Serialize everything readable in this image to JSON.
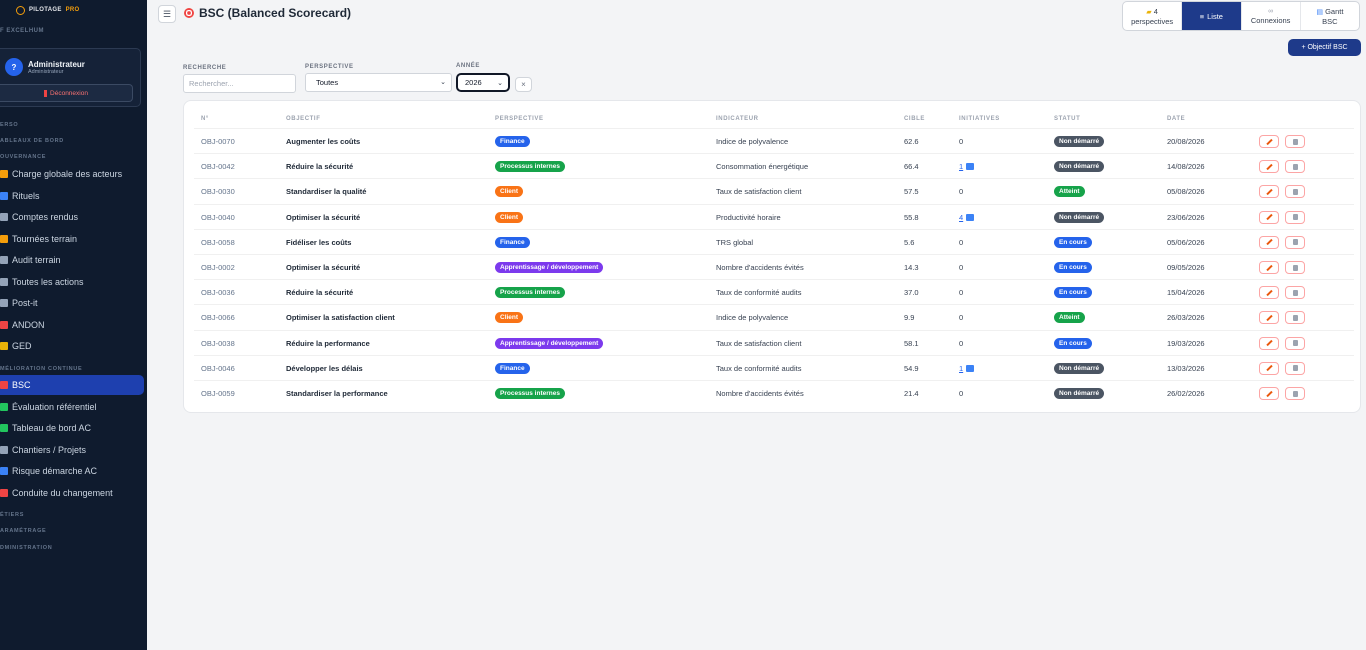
{
  "sidebar": {
    "logo_text": "PILOTAGE",
    "logo_accent": "PRO",
    "company": "F EXCELHUM",
    "user": {
      "avatar_letter": "?",
      "name": "Administrateur",
      "role": "Administrateur",
      "logout_label": "Déconnexion"
    },
    "sections": {
      "verso": "ERSO",
      "tableaux": "ABLEAUX DE BORD",
      "gouvernance": "OUVERNANCE",
      "amelioration": "MÉLIORATION CONTINUE",
      "metiers": "ÉTIERS",
      "parametrage": "ARAMÉTRAGE",
      "administration": "DMINISTRATION"
    },
    "gouvernance_items": [
      {
        "label": "Charge globale des acteurs",
        "icon": "scale-icon",
        "color": "#f59e0b"
      },
      {
        "label": "Rituels",
        "icon": "calendar-icon",
        "color": "#3b82f6"
      },
      {
        "label": "Comptes rendus",
        "icon": "document-icon",
        "color": "#94a3b8"
      },
      {
        "label": "Tournées terrain",
        "icon": "walker-icon",
        "color": "#f59e0b"
      },
      {
        "label": "Audit terrain",
        "icon": "clipboard-icon",
        "color": "#94a3b8"
      },
      {
        "label": "Toutes les actions",
        "icon": "list-icon",
        "color": "#94a3b8"
      },
      {
        "label": "Post-it",
        "icon": "note-icon",
        "color": "#94a3b8"
      },
      {
        "label": "ANDON",
        "icon": "alert-light-icon",
        "color": "#ef4444"
      },
      {
        "label": "GED",
        "icon": "folder-icon",
        "color": "#eab308"
      }
    ],
    "amelioration_items": [
      {
        "label": "BSC",
        "icon": "target-icon",
        "color": "#ef4444",
        "active": true
      },
      {
        "label": "Évaluation référentiel",
        "icon": "chart-icon",
        "color": "#22c55e"
      },
      {
        "label": "Tableau de bord AC",
        "icon": "chart-icon",
        "color": "#22c55e"
      },
      {
        "label": "Chantiers / Projets",
        "icon": "tools-icon",
        "color": "#94a3b8"
      },
      {
        "label": "Risque démarche AC",
        "icon": "shield-icon",
        "color": "#3b82f6"
      },
      {
        "label": "Conduite du changement",
        "icon": "megaphone-icon",
        "color": "#ef4444"
      }
    ]
  },
  "header": {
    "menu_icon": "hamburger-icon",
    "title": "BSC (Balanced Scorecard)",
    "views": {
      "perspectives_count": "4",
      "perspectives_label": "perspectives",
      "liste_label": "Liste",
      "connexions_label": "Connexions",
      "gantt_label_1": "Gantt",
      "gantt_label_2": "BSC"
    },
    "add_button": "+ Objectif BSC"
  },
  "filters": {
    "search_label": "RECHERCHE",
    "search_placeholder": "Rechercher...",
    "perspective_label": "PERSPECTIVE",
    "perspective_value": "Toutes",
    "year_label": "ANNÉE",
    "year_value": "2026",
    "clear_icon": "×"
  },
  "table": {
    "columns": [
      "N°",
      "OBJECTIF",
      "PERSPECTIVE",
      "INDICATEUR",
      "CIBLE",
      "INITIATIVES",
      "STATUT",
      "DATE"
    ],
    "perspective_colors": {
      "Finance": "#2563eb",
      "Processus internes": "#16a34a",
      "Client": "#f97316",
      "Apprentissage / développement": "#7c3aed"
    },
    "status_colors": {
      "Non démarré": "#4b5563",
      "Atteint": "#16a34a",
      "En cours": "#2563eb"
    },
    "rows": [
      {
        "id": "OBJ-0070",
        "objectif": "Augmenter les coûts",
        "perspective": "Finance",
        "indicateur": "Indice de polyvalence",
        "cible": "62.6",
        "initiatives": "0",
        "init_link": false,
        "statut": "Non démarré",
        "date": "20/08/2026"
      },
      {
        "id": "OBJ-0042",
        "objectif": "Réduire la sécurité",
        "perspective": "Processus internes",
        "indicateur": "Consommation énergétique",
        "cible": "66.4",
        "initiatives": "1",
        "init_link": true,
        "statut": "Non démarré",
        "date": "14/08/2026"
      },
      {
        "id": "OBJ-0030",
        "objectif": "Standardiser la qualité",
        "perspective": "Client",
        "indicateur": "Taux de satisfaction client",
        "cible": "57.5",
        "initiatives": "0",
        "init_link": false,
        "statut": "Atteint",
        "date": "05/08/2026"
      },
      {
        "id": "OBJ-0040",
        "objectif": "Optimiser la sécurité",
        "perspective": "Client",
        "indicateur": "Productivité horaire",
        "cible": "55.8",
        "initiatives": "4",
        "init_link": true,
        "statut": "Non démarré",
        "date": "23/06/2026"
      },
      {
        "id": "OBJ-0058",
        "objectif": "Fidéliser les coûts",
        "perspective": "Finance",
        "indicateur": "TRS global",
        "cible": "5.6",
        "initiatives": "0",
        "init_link": false,
        "statut": "En cours",
        "date": "05/06/2026"
      },
      {
        "id": "OBJ-0002",
        "objectif": "Optimiser la sécurité",
        "perspective": "Apprentissage / développement",
        "indicateur": "Nombre d'accidents évités",
        "cible": "14.3",
        "initiatives": "0",
        "init_link": false,
        "statut": "En cours",
        "date": "09/05/2026"
      },
      {
        "id": "OBJ-0036",
        "objectif": "Réduire la sécurité",
        "perspective": "Processus internes",
        "indicateur": "Taux de conformité audits",
        "cible": "37.0",
        "initiatives": "0",
        "init_link": false,
        "statut": "En cours",
        "date": "15/04/2026"
      },
      {
        "id": "OBJ-0066",
        "objectif": "Optimiser la satisfaction client",
        "perspective": "Client",
        "indicateur": "Indice de polyvalence",
        "cible": "9.9",
        "initiatives": "0",
        "init_link": false,
        "statut": "Atteint",
        "date": "26/03/2026"
      },
      {
        "id": "OBJ-0038",
        "objectif": "Réduire la performance",
        "perspective": "Apprentissage / développement",
        "indicateur": "Taux de satisfaction client",
        "cible": "58.1",
        "initiatives": "0",
        "init_link": false,
        "statut": "En cours",
        "date": "19/03/2026"
      },
      {
        "id": "OBJ-0046",
        "objectif": "Développer les délais",
        "perspective": "Finance",
        "indicateur": "Taux de conformité audits",
        "cible": "54.9",
        "initiatives": "1",
        "init_link": true,
        "statut": "Non démarré",
        "date": "13/03/2026"
      },
      {
        "id": "OBJ-0059",
        "objectif": "Standardiser la performance",
        "perspective": "Processus internes",
        "indicateur": "Nombre d'accidents évités",
        "cible": "21.4",
        "initiatives": "0",
        "init_link": false,
        "statut": "Non démarré",
        "date": "26/02/2026"
      }
    ]
  }
}
